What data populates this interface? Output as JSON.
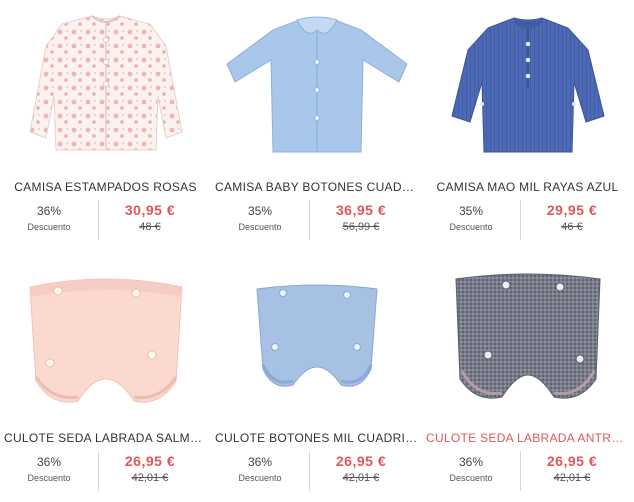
{
  "products": [
    {
      "name": "CAMISA ESTAMPADOS ROSAS",
      "discount": "36%",
      "discount_label": "Descuento",
      "price": "30,95 €",
      "old_price": "48 €",
      "image": "pink-floral-shirt"
    },
    {
      "name": "CAMISA BABY BOTONES CUADRIT...",
      "discount": "35%",
      "discount_label": "Descuento",
      "price": "36,95 €",
      "old_price": "56,99 €",
      "image": "light-blue-collar-shirt"
    },
    {
      "name": "CAMISA MAO MIL RAYAS AZUL",
      "discount": "35%",
      "discount_label": "Descuento",
      "price": "29,95 €",
      "old_price": "46 €",
      "image": "blue-mao-shirt"
    },
    {
      "name": "CULOTE SEDA LABRADA SALMON",
      "discount": "36%",
      "discount_label": "Descuento",
      "price": "26,95 €",
      "old_price": "42,01 €",
      "image": "salmon-bloomer"
    },
    {
      "name": "CULOTE BOTONES MIL CUADRITOS",
      "discount": "36%",
      "discount_label": "Descuento",
      "price": "26,95 €",
      "old_price": "42,01 €",
      "image": "blue-check-bloomer"
    },
    {
      "name": "CULOTE SEDA LABRADA ANTRACI...",
      "discount": "36%",
      "discount_label": "Descuento",
      "price": "26,95 €",
      "old_price": "42,01 €",
      "image": "grey-bloomer"
    }
  ],
  "colors": {
    "price": "#e0565b",
    "hover_title": "#e0565b",
    "text": "#333333"
  }
}
